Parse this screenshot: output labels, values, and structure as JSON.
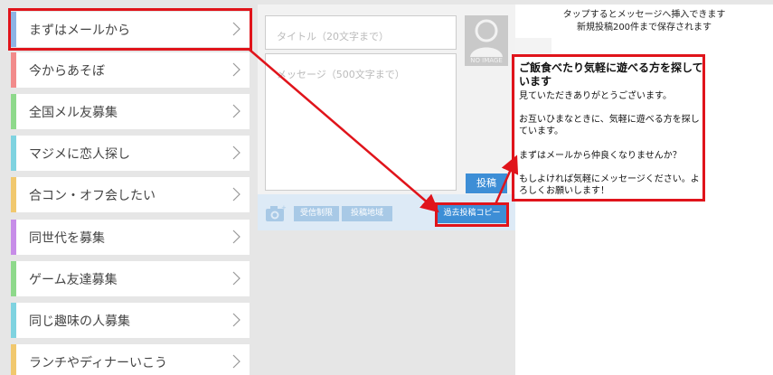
{
  "categories": [
    {
      "label": "まずはメールから",
      "color": "#8db4e5"
    },
    {
      "label": "今からあそぼ",
      "color": "#f28b8b"
    },
    {
      "label": "全国メル友募集",
      "color": "#8ed98b"
    },
    {
      "label": "マジメに恋人探し",
      "color": "#7fd3e0"
    },
    {
      "label": "合コン・オフ会したい",
      "color": "#f1c86e"
    },
    {
      "label": "同世代を募集",
      "color": "#c78de8"
    },
    {
      "label": "ゲーム友達募集",
      "color": "#8ed98b"
    },
    {
      "label": "同じ趣味の人募集",
      "color": "#7fd3e0"
    },
    {
      "label": "ランチやディナーいこう",
      "color": "#f1c86e"
    }
  ],
  "form": {
    "title_placeholder": "タイトル（20文字まで）",
    "message_placeholder": "メッセージ（500文字まで）",
    "no_image_label": "NO IMAGE",
    "post_label": "投稿",
    "receive_limit_label": "受信制限",
    "post_region_label": "投稿地域",
    "copy_past_label": "過去投稿コピー"
  },
  "panel": {
    "header_line1": "タップするとメッセージへ挿入できます",
    "header_line2": "新規投稿200件まで保存されます",
    "message_title": "ご飯食べたり気軽に遊べる方を探しています",
    "message_lines": [
      "見ていただきありがとうございます。",
      "お互いひまなときに、気軽に遊べる方を探しています。",
      "まずはメールから仲良くなりませんか？",
      "もしよければ気軽にメッセージください。よろしくお願いします！"
    ]
  },
  "colors": {
    "accent_blue": "#3d8ed6",
    "annotation_red": "#e0141b"
  }
}
